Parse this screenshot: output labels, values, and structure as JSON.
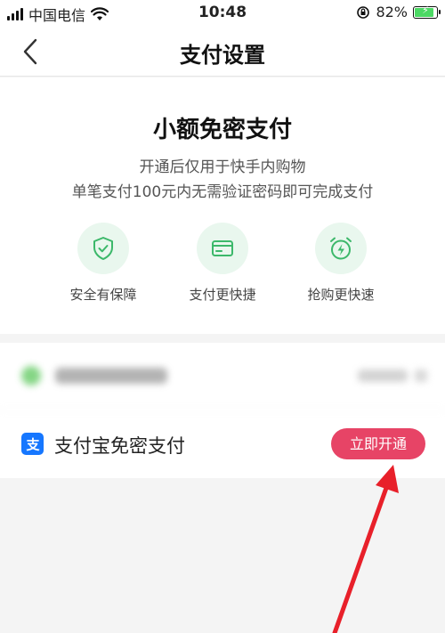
{
  "status_bar": {
    "carrier": "中国电信",
    "time": "10:48",
    "battery": "82%",
    "battery_level": 0.82
  },
  "nav": {
    "title": "支付设置",
    "back_icon": "chevron-left-icon"
  },
  "promo": {
    "title": "小额免密支付",
    "desc_line1": "开通后仅用于快手内购物",
    "desc_line2": "单笔支付100元内无需验证密码即可完成支付",
    "features": [
      {
        "label": "安全有保障",
        "icon": "shield-check-icon"
      },
      {
        "label": "支付更快捷",
        "icon": "card-icon"
      },
      {
        "label": "抢购更快速",
        "icon": "alarm-bolt-icon"
      }
    ]
  },
  "payments": [
    {
      "label": "",
      "icon": "wechat-icon",
      "blurred": true
    },
    {
      "label": "支付宝免密支付",
      "icon": "alipay-icon",
      "button": "立即开通",
      "logo_glyph": "支"
    }
  ],
  "colors": {
    "accent_green": "#3cb86a",
    "button_red": "#e74466",
    "alipay_blue": "#1677ff",
    "annotation_arrow": "#e8202a"
  }
}
